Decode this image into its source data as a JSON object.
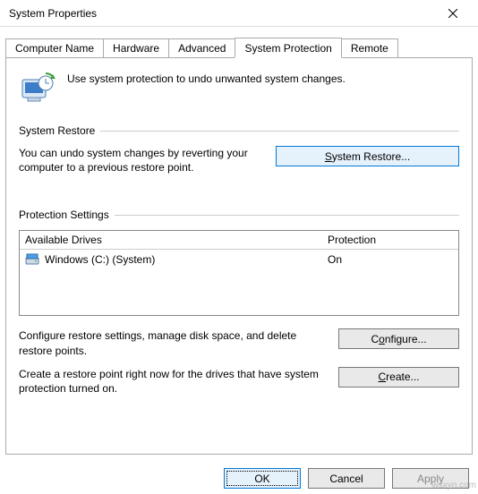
{
  "window": {
    "title": "System Properties"
  },
  "tabs": {
    "computer_name": "Computer Name",
    "hardware": "Hardware",
    "advanced": "Advanced",
    "system_protection": "System Protection",
    "remote": "Remote"
  },
  "header_text": "Use system protection to undo unwanted system changes.",
  "restore_group": {
    "legend": "System Restore",
    "desc": "You can undo system changes by reverting your computer to a previous restore point.",
    "button_prefix": "S",
    "button_rest": "ystem Restore..."
  },
  "protection_group": {
    "legend": "Protection Settings",
    "col_drives": "Available Drives",
    "col_protection": "Protection",
    "drive_name": "Windows (C:) (System)",
    "drive_status": "On",
    "configure_desc": "Configure restore settings, manage disk space, and delete restore points.",
    "configure_btn_prefix": "C",
    "configure_btn_mn": "o",
    "configure_btn_rest": "nfigure...",
    "create_desc": "Create a restore point right now for the drives that have system protection turned on.",
    "create_btn_mn": "C",
    "create_btn_rest": "reate..."
  },
  "dialog_buttons": {
    "ok": "OK",
    "cancel": "Cancel",
    "apply": "Apply"
  },
  "watermark": "wsxyn.com"
}
